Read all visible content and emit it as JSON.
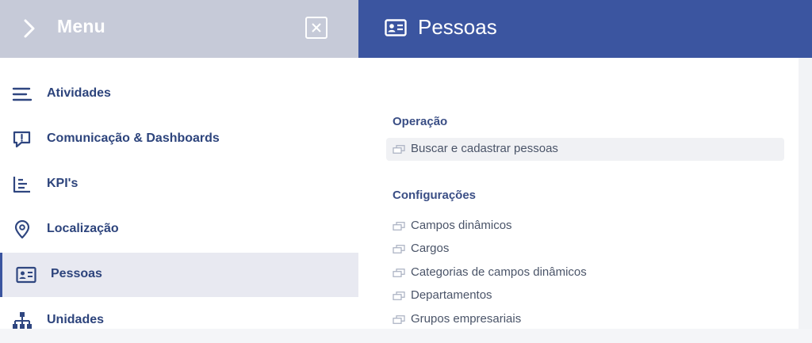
{
  "menu": {
    "title": "Menu",
    "items": [
      {
        "label": "Atividades",
        "icon": "list-icon"
      },
      {
        "label": "Comunicação & Dashboards",
        "icon": "chat-alert-icon"
      },
      {
        "label": "KPI's",
        "icon": "bar-chart-icon"
      },
      {
        "label": "Localização",
        "icon": "location-pin-icon"
      },
      {
        "label": "Pessoas",
        "icon": "id-card-icon",
        "active": true
      },
      {
        "label": "Unidades",
        "icon": "org-chart-icon"
      }
    ]
  },
  "page": {
    "title": "Pessoas",
    "sections": [
      {
        "title": "Operação",
        "items": [
          "Buscar e cadastrar pessoas"
        ]
      },
      {
        "title": "Configurações",
        "items": [
          "Campos dinâmicos",
          "Cargos",
          "Categorias de campos dinâmicos",
          "Departamentos",
          "Grupos empresariais"
        ]
      }
    ]
  },
  "colors": {
    "accent": "#3b55a0",
    "menu_header": "#c6cad8",
    "text": "#2d447c"
  }
}
